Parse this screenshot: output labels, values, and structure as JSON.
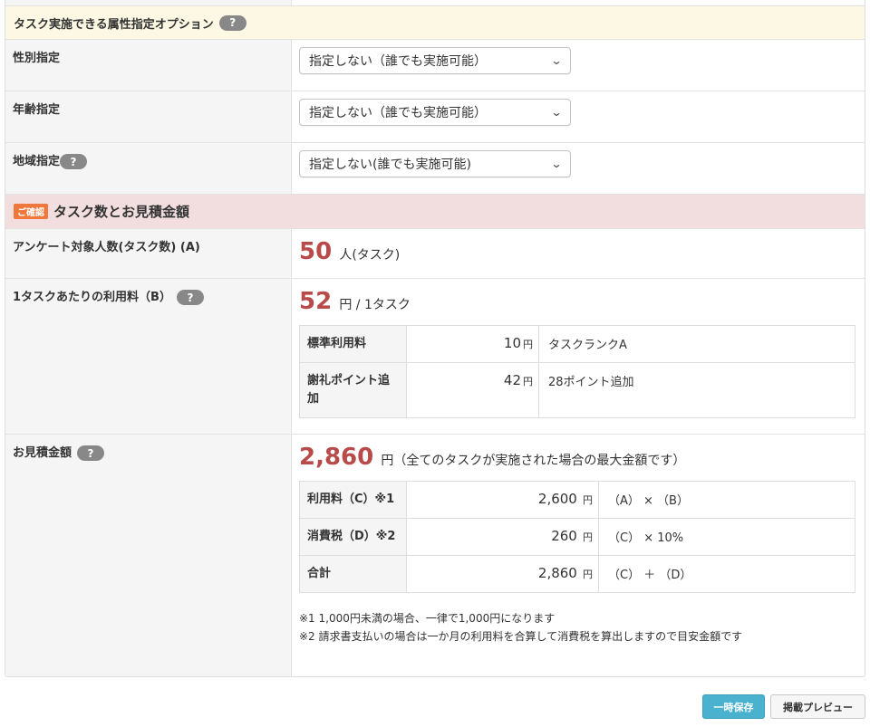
{
  "options_section": {
    "title": "タスク実施できる属性指定オプション",
    "help": "?"
  },
  "gender": {
    "label": "性別指定",
    "value": "指定しない（誰でも実施可能）"
  },
  "age": {
    "label": "年齢指定",
    "value": "指定しない（誰でも実施可能）"
  },
  "region": {
    "label": "地域指定",
    "help": "?",
    "value": "指定しない(誰でも実施可能)"
  },
  "confirm_section": {
    "badge": "ご確認",
    "title": "タスク数とお見積金額"
  },
  "respondents": {
    "label": "アンケート対象人数(タスク数) (A)",
    "value": "50",
    "unit": "人(タスク)"
  },
  "per_task": {
    "label": "1タスクあたりの利用料（B）",
    "help": "?",
    "value": "52",
    "unit": "円 / 1タスク",
    "rows": [
      {
        "head": "標準利用料",
        "amount": "10",
        "yen": "円",
        "note": "タスクランクA"
      },
      {
        "head": "謝礼ポイント追加",
        "amount": "42",
        "yen": "円",
        "note": "28ポイント追加"
      }
    ]
  },
  "estimate": {
    "label": "お見積金額",
    "help": "?",
    "value": "2,860",
    "unit": "円（全てのタスクが実施された場合の最大金額です）",
    "rows": [
      {
        "head": "利用料（C）※1",
        "amount": "2,600",
        "yen": "円",
        "note": "（A） × （B）"
      },
      {
        "head": "消費税（D）※2",
        "amount": "260",
        "yen": "円",
        "note": "（C） × 10%"
      },
      {
        "head": "合計",
        "amount": "2,860",
        "yen": "円",
        "note": "（C） ＋ （D）"
      }
    ],
    "notes": [
      "※1 1,000円未満の場合、一律で1,000円になります",
      "※2 請求書支払いの場合は一か月の利用料を合算して消費税を算出しますので目安金額です"
    ]
  },
  "buttons": {
    "save": "一時保存",
    "preview": "掲載プレビュー"
  },
  "colors": {
    "accent_red": "#b84a4a",
    "primary_button": "#4ab2cf",
    "confirm_badge": "#f0783c"
  }
}
